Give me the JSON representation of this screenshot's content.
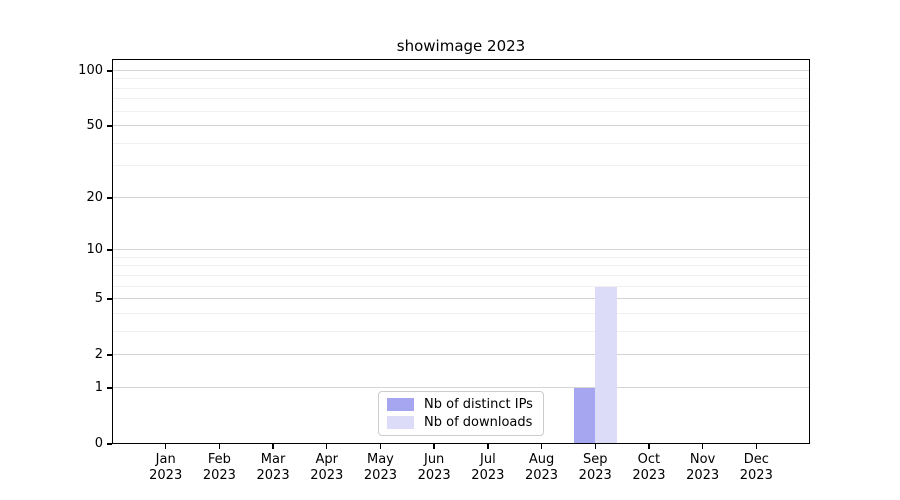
{
  "figure": {
    "background": "#ffffff"
  },
  "chart_data": {
    "type": "bar",
    "title": "showimage 2023",
    "xlabel": "",
    "ylabel": "",
    "categories": [
      "Jan 2023",
      "Feb 2023",
      "Mar 2023",
      "Apr 2023",
      "May 2023",
      "Jun 2023",
      "Jul 2023",
      "Aug 2023",
      "Sep 2023",
      "Oct 2023",
      "Nov 2023",
      "Dec 2023"
    ],
    "series": [
      {
        "name": "Nb of distinct IPs",
        "color": "#a6a6f0",
        "values": [
          0,
          0,
          0,
          0,
          0,
          0,
          0,
          0,
          1,
          0,
          0,
          0
        ]
      },
      {
        "name": "Nb of downloads",
        "color": "#dcdcf8",
        "values": [
          0,
          0,
          0,
          0,
          0,
          0,
          0,
          0,
          6,
          0,
          0,
          0
        ]
      }
    ],
    "yscale": "log1p",
    "ylim": [
      0,
      115
    ],
    "yticks": [
      0,
      1,
      2,
      5,
      10,
      20,
      50,
      100
    ],
    "minor_yticks": [
      3,
      4,
      6,
      7,
      8,
      9,
      30,
      40,
      60,
      70,
      80,
      90
    ],
    "grid": true,
    "legend_position": "lower center",
    "bar_width_fraction": 0.4
  },
  "colors": {
    "major_grid": "#d4d4d4",
    "minor_grid": "#f0f0f0",
    "spine": "#000000",
    "text": "#000000",
    "legend_border": "#cccccc",
    "legend_bg": "#ffffff"
  }
}
